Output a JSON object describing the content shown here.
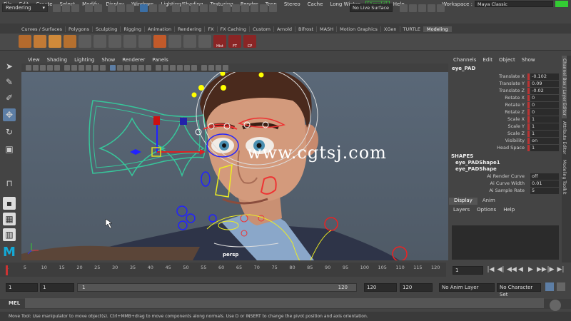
{
  "menus": [
    "File",
    "Edit",
    "Create",
    "Select",
    "Modify",
    "Display",
    "Windows",
    "Lighting/Shading",
    "Texturing",
    "Render",
    "Toon",
    "Stereo",
    "Cache",
    "Long Winter",
    "[Arnold]",
    "Help"
  ],
  "workspace_label": "Workspace :",
  "workspace_value": "Maya Classic",
  "mode_dropdown": "Rendering",
  "no_live_surface": "No Live Surface",
  "shelf_tabs": [
    "Curves / Surfaces",
    "Polygons",
    "Sculpting",
    "Rigging",
    "Animation",
    "Rendering",
    "FX",
    "FX Caching",
    "Custom",
    "Arnold",
    "Bifrost",
    "MASH",
    "Motion Graphics",
    "XGen",
    "TURTLE",
    "Modeling"
  ],
  "shelf_active_tab": "Modeling",
  "shelf_button_labels": [
    "Hist",
    "FT",
    "CP"
  ],
  "viewport_menu": [
    "View",
    "Shading",
    "Lighting",
    "Show",
    "Renderer",
    "Panels"
  ],
  "viewport_camera": "persp",
  "watermark": "www.cgtsj.com",
  "channelbox": {
    "menu": [
      "Channels",
      "Edit",
      "Object",
      "Show"
    ],
    "node_name": "eye_PAD",
    "channels": [
      {
        "name": "Translate X",
        "value": "-0.102"
      },
      {
        "name": "Translate Y",
        "value": "0.09"
      },
      {
        "name": "Translate Z",
        "value": "-0.02"
      },
      {
        "name": "Rotate X",
        "value": "0"
      },
      {
        "name": "Rotate Y",
        "value": "0"
      },
      {
        "name": "Rotate Z",
        "value": "0"
      },
      {
        "name": "Scale X",
        "value": "1"
      },
      {
        "name": "Scale Y",
        "value": "1"
      },
      {
        "name": "Scale Z",
        "value": "1"
      },
      {
        "name": "Visibility",
        "value": "on"
      },
      {
        "name": "Head Space",
        "value": "1"
      }
    ],
    "shapes_header": "SHAPES",
    "shapes": [
      "eye_PADShape1",
      "eye_PADShape"
    ],
    "shape_channels": [
      {
        "name": "Ai Render Curve",
        "value": "off"
      },
      {
        "name": "Ai Curve Width",
        "value": "0.01"
      },
      {
        "name": "Ai Sample Rate",
        "value": "5"
      }
    ]
  },
  "layer_editor": {
    "tabs": [
      "Display",
      "Anim"
    ],
    "menu": [
      "Layers",
      "Options",
      "Help"
    ]
  },
  "side_tabs": [
    "Channel Box / Layer Editor",
    "Attribute Editor",
    "Modeling Toolkit"
  ],
  "timeline": {
    "ticks": [
      "1",
      "5",
      "10",
      "15",
      "20",
      "25",
      "30",
      "35",
      "40",
      "45",
      "50",
      "55",
      "60",
      "65",
      "70",
      "75",
      "80",
      "85",
      "90",
      "95",
      "100",
      "105",
      "110",
      "115",
      "120"
    ],
    "current_frame": "1",
    "playback_icons": [
      "|◀",
      "◀|",
      "◀◀",
      "◀",
      "▶",
      "▶▶",
      "|▶",
      "▶|"
    ]
  },
  "range": {
    "start": "1",
    "playback_start": "1",
    "slider_left": "1",
    "slider_right": "120",
    "playback_end": "120",
    "end": "120",
    "anim_layer": "No Anim Layer",
    "character_set": "No Character Set"
  },
  "command_line_label": "MEL",
  "help_line": "Move Tool: Use manipulator to move object(s). Ctrl+MMB+drag to move components along normals. Use D or INSERT to change the pivot position and axis orientation."
}
